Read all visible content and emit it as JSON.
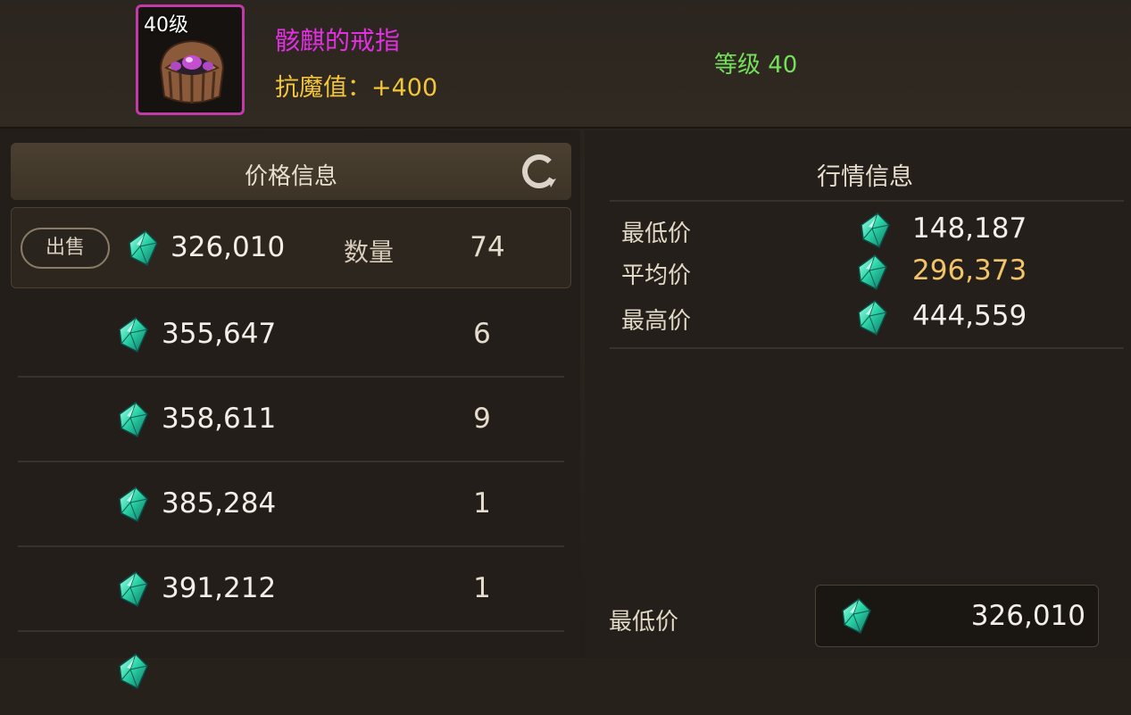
{
  "item": {
    "level_badge": "40级",
    "name": "骸麒的戒指",
    "stat": "抗魔值：+400",
    "grade": "等级 40"
  },
  "price_panel": {
    "title": "价格信息",
    "sell_label": "出售",
    "qty_label": "数量",
    "rows": [
      {
        "price": "326,010",
        "qty": "74"
      },
      {
        "price": "355,647",
        "qty": "6"
      },
      {
        "price": "358,611",
        "qty": "9"
      },
      {
        "price": "385,284",
        "qty": "1"
      },
      {
        "price": "391,212",
        "qty": "1"
      }
    ]
  },
  "market_panel": {
    "title": "行情信息",
    "stats": [
      {
        "label": "最低价",
        "value": "148,187"
      },
      {
        "label": "平均价",
        "value": "296,373"
      },
      {
        "label": "最高价",
        "value": "444,559"
      }
    ],
    "bottom_label": "最低价",
    "bottom_value": "326,010"
  },
  "icons": {
    "currency": "gem-icon",
    "refresh": "refresh-icon",
    "item": "ring-item-icon"
  },
  "colors": {
    "item_name": "#e030e0",
    "stat": "#f2c53a",
    "grade": "#74e05a",
    "avg_value": "#f2c46a",
    "item_border": "#c23aa8"
  }
}
